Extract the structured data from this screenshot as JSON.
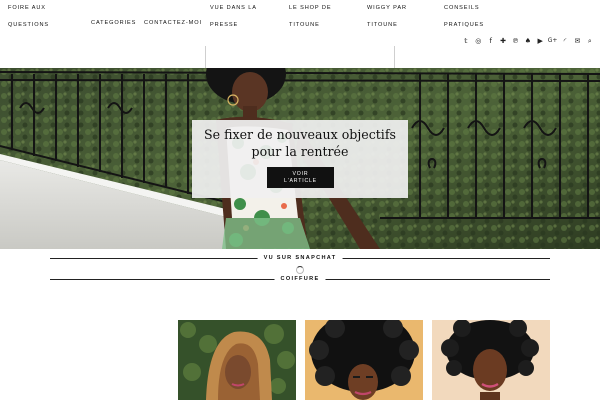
{
  "nav": {
    "items": [
      {
        "id": "faq",
        "lines": [
          "Foire aux",
          "questions"
        ]
      },
      {
        "id": "categories",
        "lines": [
          "Categories"
        ]
      },
      {
        "id": "contact",
        "lines": [
          "Contactez-moi"
        ]
      },
      {
        "id": "press",
        "lines": [
          "Vue dans la",
          "presse"
        ]
      },
      {
        "id": "shop",
        "lines": [
          "Le shop de",
          "Titoune"
        ]
      },
      {
        "id": "wiggy",
        "lines": [
          "Wiggy par",
          "Titoune"
        ]
      },
      {
        "id": "tips",
        "lines": [
          "Conseils",
          "pratiques"
        ]
      }
    ]
  },
  "social": [
    {
      "name": "twitter-icon",
      "glyph": "𝕥"
    },
    {
      "name": "instagram-icon",
      "glyph": "◎"
    },
    {
      "name": "facebook-icon",
      "glyph": "f"
    },
    {
      "name": "bloglovin-icon",
      "glyph": "✚"
    },
    {
      "name": "pinterest-icon",
      "glyph": "℗"
    },
    {
      "name": "snapchat-icon",
      "glyph": "♠"
    },
    {
      "name": "youtube-icon",
      "glyph": "▶"
    },
    {
      "name": "google-plus-icon",
      "glyph": "G+"
    },
    {
      "name": "rss-icon",
      "glyph": "◜"
    },
    {
      "name": "email-icon",
      "glyph": "✉"
    },
    {
      "name": "search-icon",
      "glyph": "⌕"
    }
  ],
  "hero": {
    "title": "Se fixer de nouveaux objectifs pour la rentrée",
    "button_line1": "Voir",
    "button_line2": "l'article"
  },
  "sections": {
    "snapchat": "Vu sur Snapchat",
    "hair": "Coiffure"
  },
  "colors": {
    "text": "#111111",
    "button_bg": "#111111",
    "card_bg": "#f0f0f0"
  }
}
